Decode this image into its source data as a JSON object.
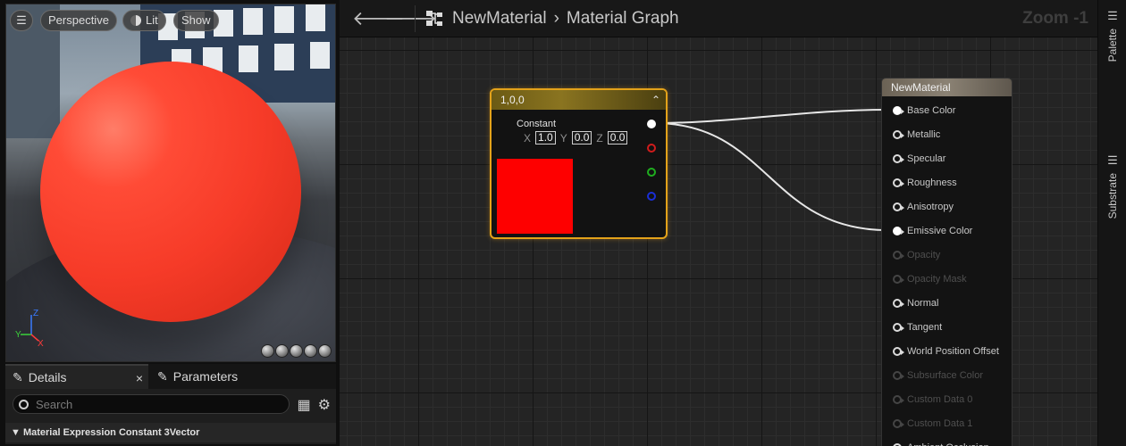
{
  "viewport": {
    "buttons": {
      "menu": "☰",
      "perspective": "Perspective",
      "lit": "Lit",
      "show": "Show"
    },
    "axis": {
      "z": "Z",
      "y": "Y",
      "x": "X"
    }
  },
  "details": {
    "tabs": [
      {
        "label": "Details"
      },
      {
        "label": "Parameters"
      }
    ],
    "close_glyph": "×",
    "search_placeholder": "Search",
    "section": "Material Expression Constant 3Vector"
  },
  "graph": {
    "breadcrumb": {
      "asset": "NewMaterial",
      "separator": "›",
      "graph": "Material Graph"
    },
    "zoom": "Zoom -1",
    "constant_node": {
      "title": "1,0,0",
      "label": "Constant",
      "x_label": "X",
      "x_value": "1.0",
      "y_label": "Y",
      "y_value": "0.0",
      "z_label": "Z",
      "z_value": "0.0",
      "swatch_color": "#fe0000"
    },
    "result_node": {
      "title": "NewMaterial",
      "inputs": [
        {
          "label": "Base Color",
          "connected": true,
          "enabled": true
        },
        {
          "label": "Metallic",
          "connected": false,
          "enabled": true
        },
        {
          "label": "Specular",
          "connected": false,
          "enabled": true
        },
        {
          "label": "Roughness",
          "connected": false,
          "enabled": true
        },
        {
          "label": "Anisotropy",
          "connected": false,
          "enabled": true
        },
        {
          "label": "Emissive Color",
          "connected": true,
          "enabled": true
        },
        {
          "label": "Opacity",
          "connected": false,
          "enabled": false
        },
        {
          "label": "Opacity Mask",
          "connected": false,
          "enabled": false
        },
        {
          "label": "Normal",
          "connected": false,
          "enabled": true
        },
        {
          "label": "Tangent",
          "connected": false,
          "enabled": true
        },
        {
          "label": "World Position Offset",
          "connected": false,
          "enabled": true
        },
        {
          "label": "Subsurface Color",
          "connected": false,
          "enabled": false
        },
        {
          "label": "Custom Data 0",
          "connected": false,
          "enabled": false
        },
        {
          "label": "Custom Data 1",
          "connected": false,
          "enabled": false
        },
        {
          "label": "Ambient Occlusion",
          "connected": false,
          "enabled": true
        }
      ]
    }
  },
  "side_panel": {
    "palette": "Palette",
    "substrate": "Substrate"
  },
  "colors": {
    "node_selected": "#e3a21a",
    "swatch": "#fe0000",
    "sphere": "#f63b28"
  }
}
